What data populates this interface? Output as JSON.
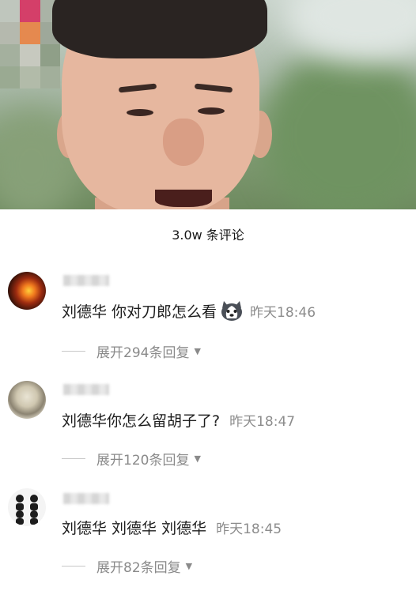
{
  "video": {
    "description_icon": "video-frame"
  },
  "header": {
    "count_label": "3.0w 条评论"
  },
  "comments": [
    {
      "text": "刘德华 你对刀郎怎么看",
      "emoji_icon": "husky-dog-emoji-icon",
      "time": "昨天18:46",
      "replies": "展开294条回复"
    },
    {
      "text": "刘德华你怎么留胡子了?",
      "time": "昨天18:47",
      "replies": "展开120条回复"
    },
    {
      "text": "刘德华 刘德华 刘德华",
      "time": "昨天18:45",
      "replies": "展开82条回复"
    }
  ],
  "colors": {
    "time_gray": "#8c8c8c",
    "text": "#1c1c1c"
  }
}
